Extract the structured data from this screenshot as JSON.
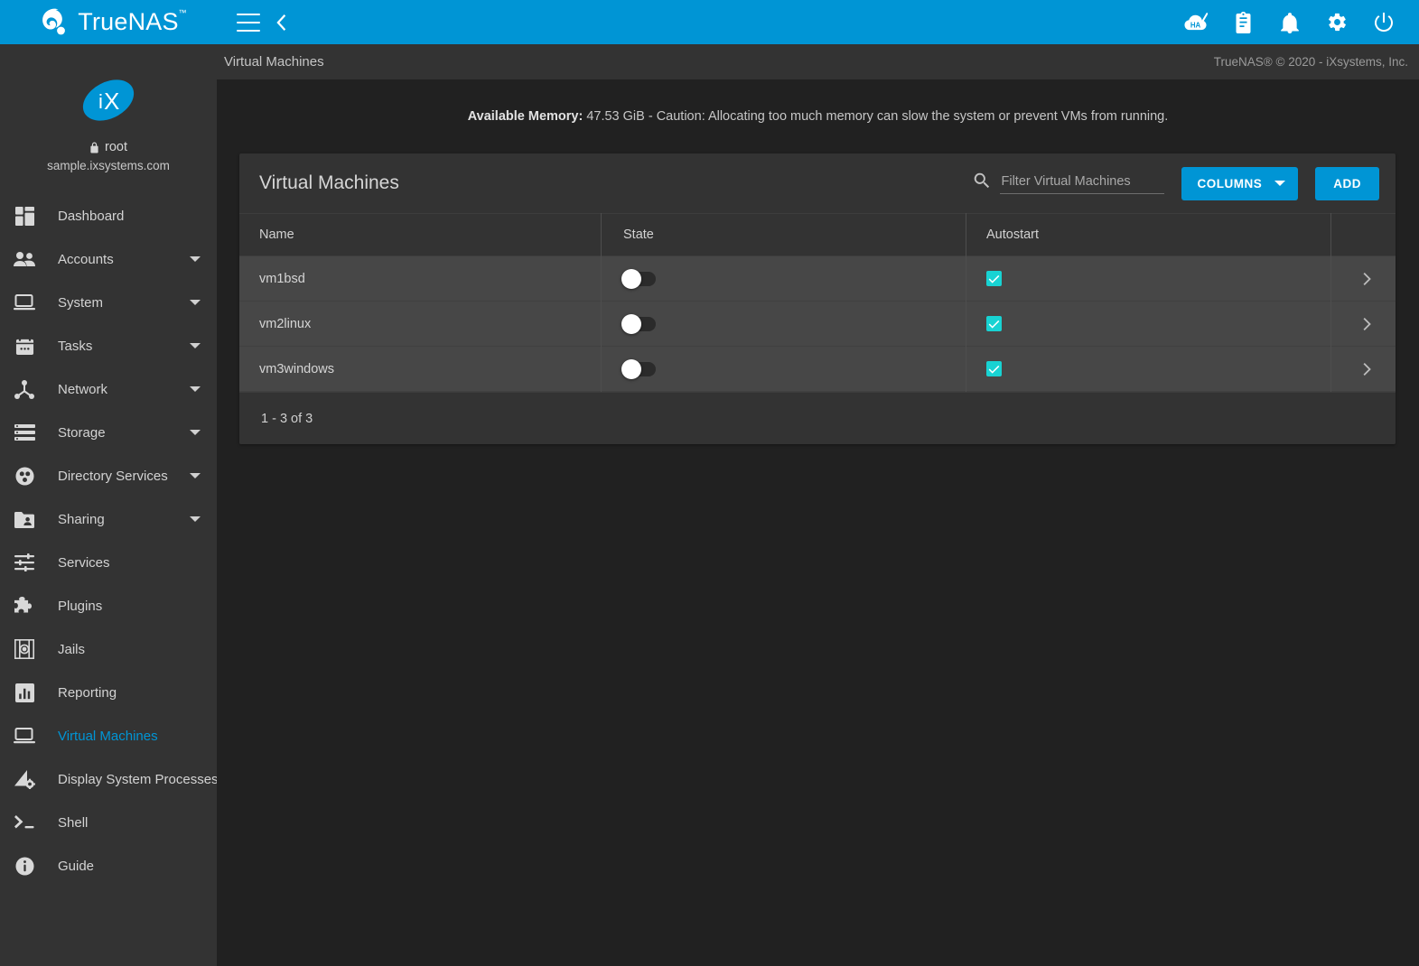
{
  "brand": {
    "name": "TrueNAS",
    "trademark": "™",
    "logo_icon": "truenas-logo-icon"
  },
  "topbar": {
    "menu_toggle_icon": "hamburger-menu-icon",
    "back_icon": "chevron-left-icon",
    "icons": [
      {
        "name": "ha-status-icon",
        "label": "HA"
      },
      {
        "name": "task-manager-icon",
        "label": ""
      },
      {
        "name": "notifications-bell-icon",
        "label": ""
      },
      {
        "name": "settings-gear-icon",
        "label": ""
      },
      {
        "name": "power-icon",
        "label": ""
      }
    ],
    "accent_color": "#0095d5"
  },
  "sidebar": {
    "logo_icon": "ix-systems-logo-icon",
    "lock_icon": "lock-icon",
    "username": "root",
    "hostname": "sample.ixsystems.com",
    "items": [
      {
        "label": "Dashboard",
        "icon": "dashboard-icon",
        "expandable": false,
        "active": false
      },
      {
        "label": "Accounts",
        "icon": "accounts-people-icon",
        "expandable": true,
        "active": false
      },
      {
        "label": "System",
        "icon": "system-laptop-icon",
        "expandable": true,
        "active": false
      },
      {
        "label": "Tasks",
        "icon": "tasks-calendar-icon",
        "expandable": true,
        "active": false
      },
      {
        "label": "Network",
        "icon": "network-nodes-icon",
        "expandable": true,
        "active": false
      },
      {
        "label": "Storage",
        "icon": "storage-list-icon",
        "expandable": true,
        "active": false
      },
      {
        "label": "Directory Services",
        "icon": "directory-services-icon",
        "expandable": true,
        "active": false
      },
      {
        "label": "Sharing",
        "icon": "sharing-folder-icon",
        "expandable": true,
        "active": false
      },
      {
        "label": "Services",
        "icon": "services-sliders-icon",
        "expandable": false,
        "active": false
      },
      {
        "label": "Plugins",
        "icon": "plugins-puzzle-icon",
        "expandable": false,
        "active": false
      },
      {
        "label": "Jails",
        "icon": "jails-icon",
        "expandable": false,
        "active": false
      },
      {
        "label": "Reporting",
        "icon": "reporting-chart-icon",
        "expandable": false,
        "active": false
      },
      {
        "label": "Virtual Machines",
        "icon": "virtual-machines-icon",
        "expandable": false,
        "active": true
      },
      {
        "label": "Display System Processes",
        "icon": "system-processes-icon",
        "expandable": false,
        "active": false
      },
      {
        "label": "Shell",
        "icon": "shell-terminal-icon",
        "expandable": false,
        "active": false
      },
      {
        "label": "Guide",
        "icon": "guide-info-icon",
        "expandable": false,
        "active": false
      }
    ],
    "active_color": "#0095d5"
  },
  "breadcrumb": {
    "title": "Virtual Machines",
    "copyright": "TrueNAS® © 2020 - iXsystems, Inc."
  },
  "notice": {
    "label": "Available Memory:",
    "text": " 47.53 GiB - Caution: Allocating too much memory can slow the system or prevent VMs from running."
  },
  "card": {
    "title": "Virtual Machines",
    "search": {
      "icon": "search-icon",
      "placeholder": "Filter Virtual Machines",
      "value": ""
    },
    "columns_button": "COLUMNS",
    "columns_caret_icon": "chevron-down-icon",
    "add_button": "ADD"
  },
  "table": {
    "headers": [
      "Name",
      "State",
      "Autostart",
      ""
    ],
    "rows": [
      {
        "name": "vm1bsd",
        "state_on": false,
        "autostart": true,
        "expand_icon": "chevron-right-icon"
      },
      {
        "name": "vm2linux",
        "state_on": false,
        "autostart": true,
        "expand_icon": "chevron-right-icon"
      },
      {
        "name": "vm3windows",
        "state_on": false,
        "autostart": true,
        "expand_icon": "chevron-right-icon"
      }
    ],
    "footer": "1 - 3 of 3",
    "checkbox_color": "#18d3d3"
  }
}
